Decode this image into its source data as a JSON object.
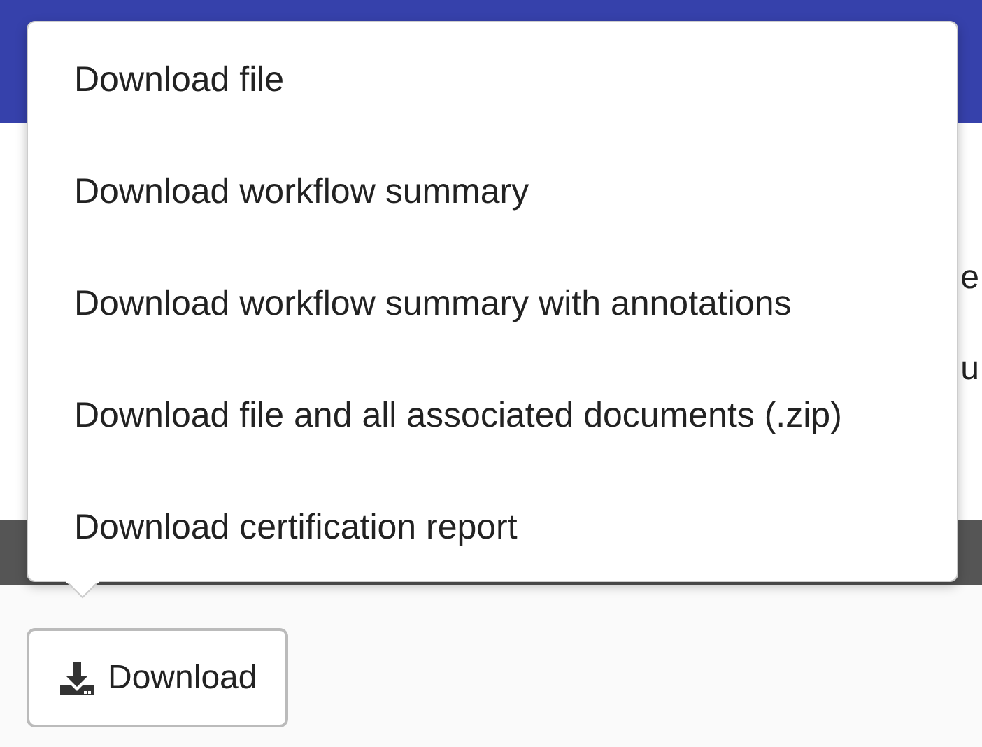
{
  "page_text_fragments": [
    "e",
    "u"
  ],
  "download_menu": {
    "items": [
      {
        "label": "Download file"
      },
      {
        "label": "Download workflow summary"
      },
      {
        "label": "Download workflow summary with annotations"
      },
      {
        "label": "Download file and all associated documents (.zip)"
      },
      {
        "label": "Download certification report"
      }
    ]
  },
  "download_button": {
    "label": "Download"
  }
}
